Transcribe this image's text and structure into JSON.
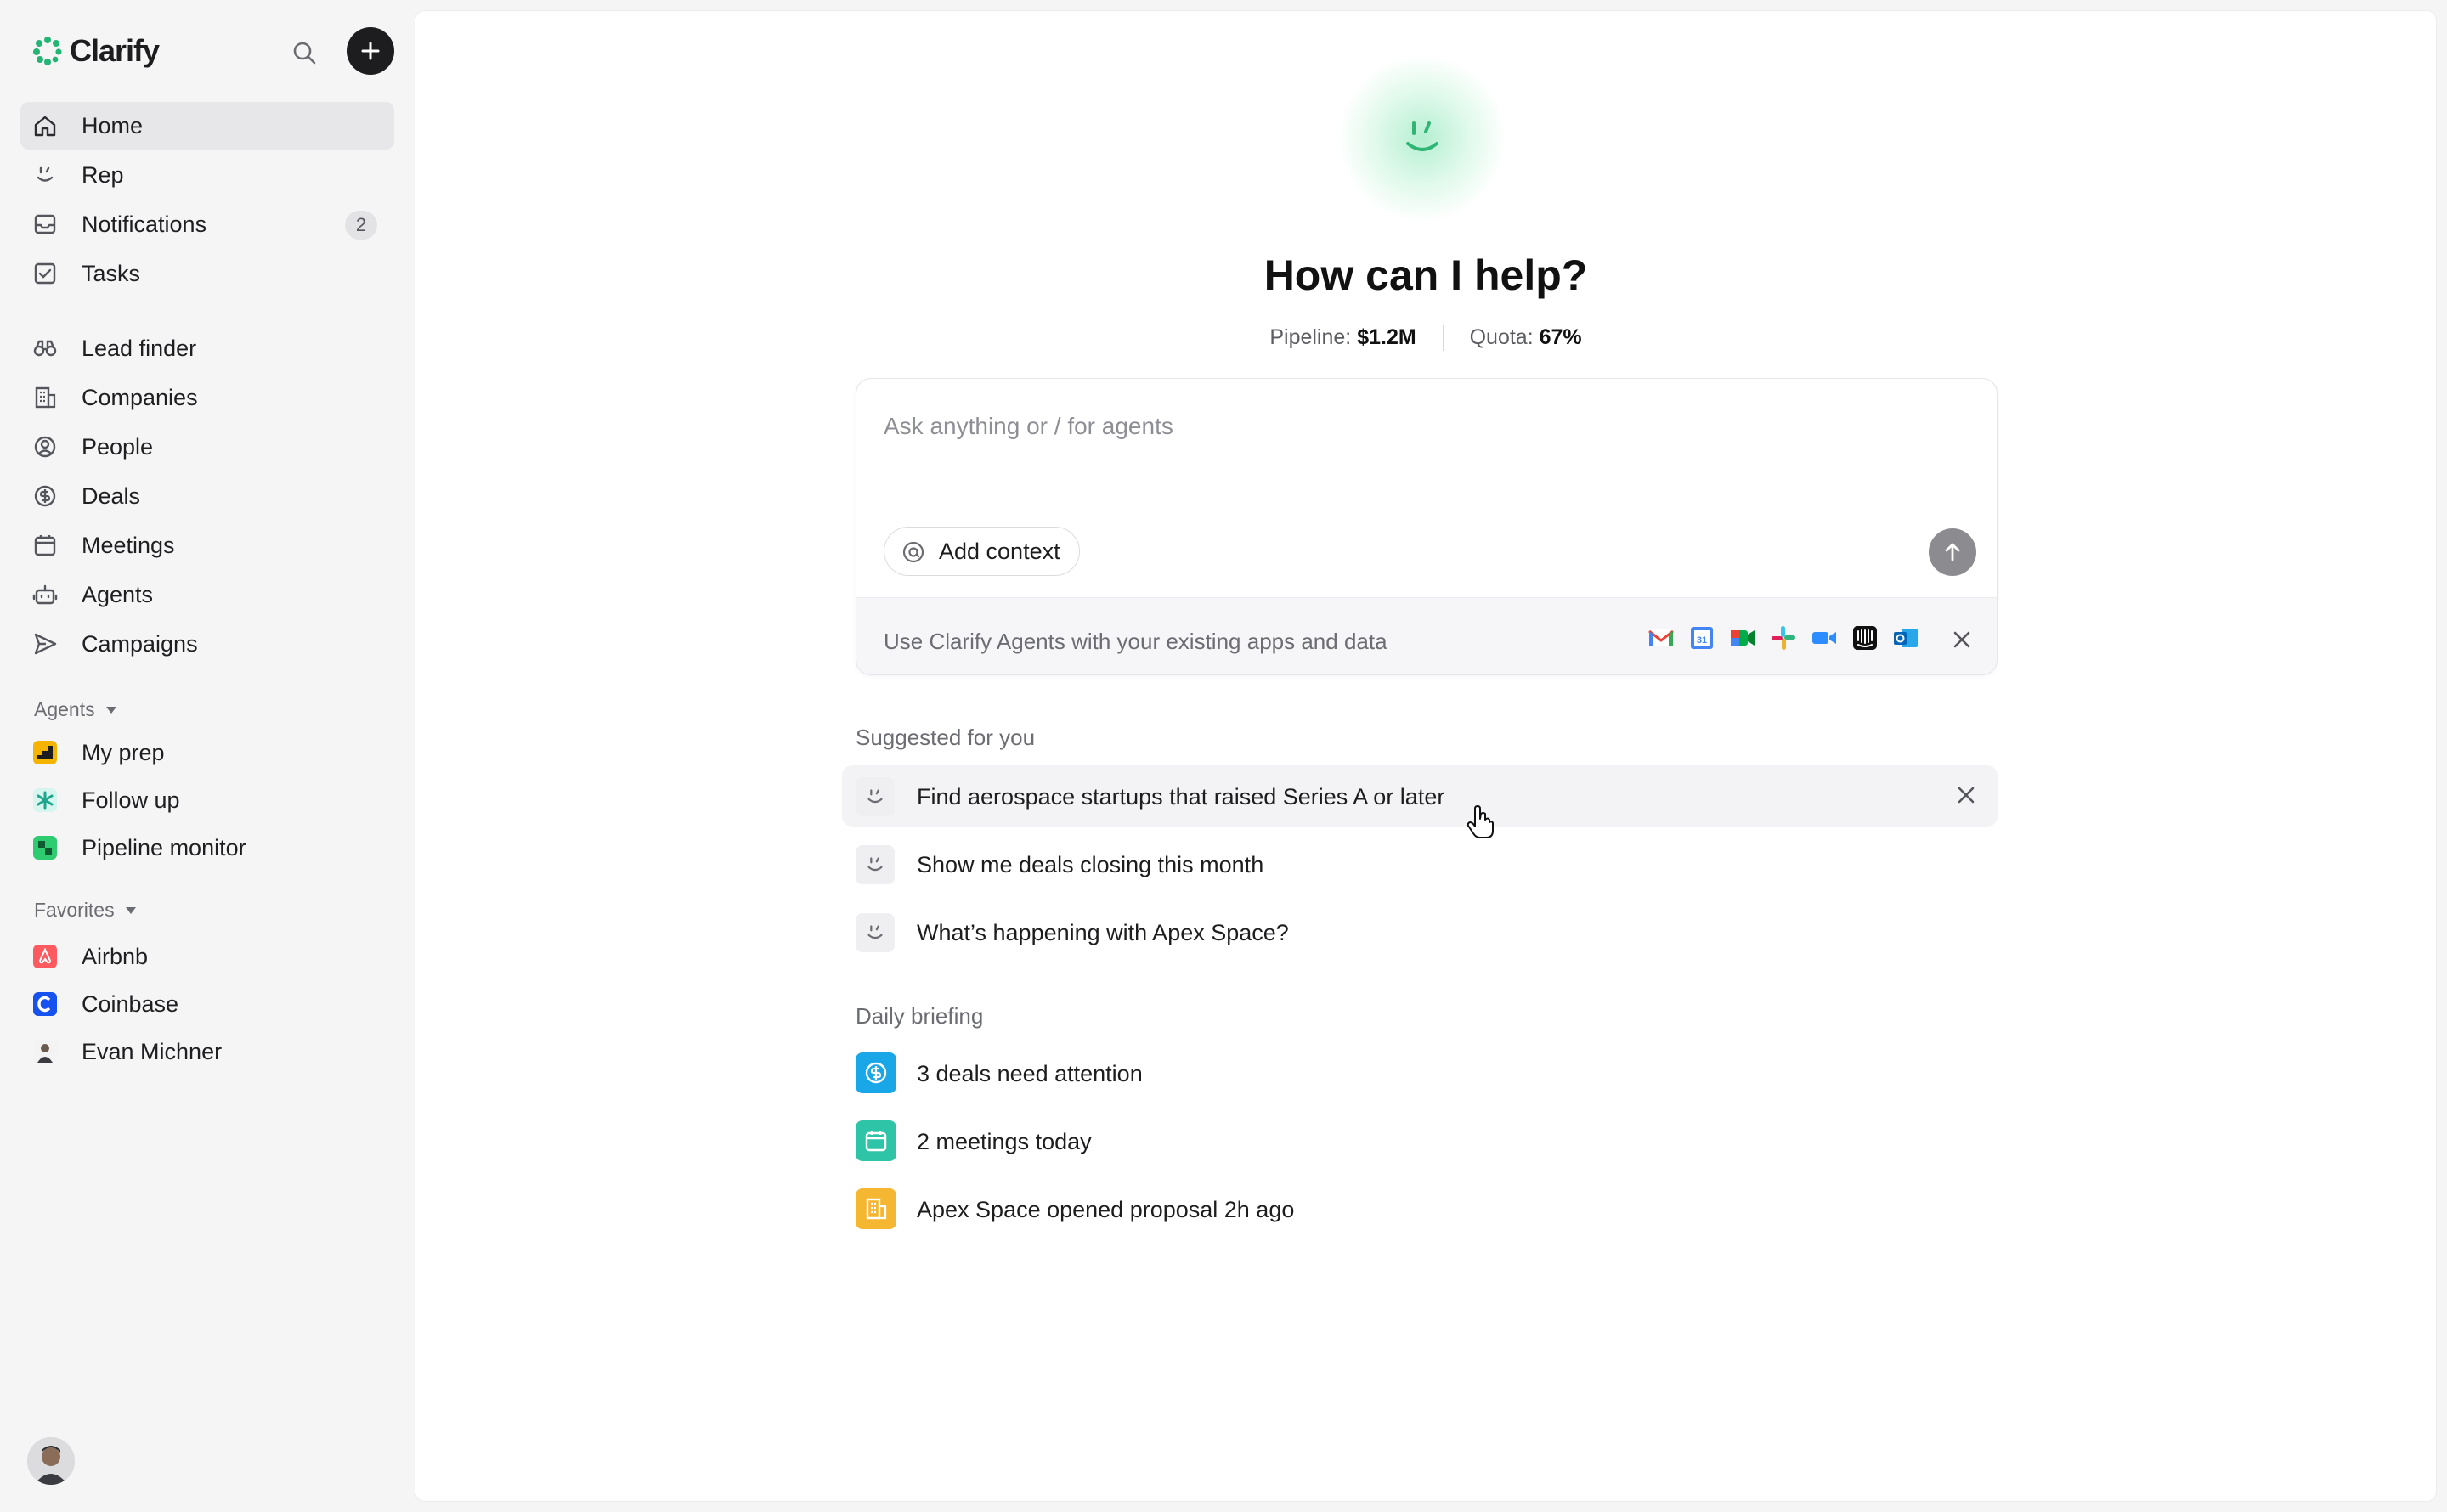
{
  "app": {
    "name": "Clarify",
    "brand_color": "#22b573"
  },
  "sidebar": {
    "nav": [
      {
        "label": "Home",
        "icon": "home-icon",
        "active": true
      },
      {
        "label": "Rep",
        "icon": "rep-face-icon"
      },
      {
        "label": "Notifications",
        "icon": "inbox-icon",
        "badge": "2"
      },
      {
        "label": "Tasks",
        "icon": "checkbox-icon"
      }
    ],
    "records": [
      {
        "label": "Lead finder",
        "icon": "binoculars-icon"
      },
      {
        "label": "Companies",
        "icon": "building-icon"
      },
      {
        "label": "People",
        "icon": "person-circle-icon"
      },
      {
        "label": "Deals",
        "icon": "dollar-circle-icon"
      },
      {
        "label": "Meetings",
        "icon": "calendar-icon"
      },
      {
        "label": "Agents",
        "icon": "robot-icon"
      },
      {
        "label": "Campaigns",
        "icon": "send-icon"
      }
    ],
    "agents_section": {
      "label": "Agents",
      "items": [
        {
          "label": "My prep",
          "color": "#f5b400"
        },
        {
          "label": "Follow up",
          "color": "#2bc4a8"
        },
        {
          "label": "Pipeline monitor",
          "color": "#2ecc71"
        }
      ]
    },
    "favorites_section": {
      "label": "Favorites",
      "items": [
        {
          "label": "Airbnb",
          "color": "#ff5a5f"
        },
        {
          "label": "Coinbase",
          "color": "#1652f0"
        },
        {
          "label": "Evan Michner",
          "color": "#9a9aa0"
        }
      ]
    }
  },
  "main": {
    "title": "How can I help?",
    "pipeline_label": "Pipeline:",
    "pipeline_value": "$1.2M",
    "quota_label": "Quota:",
    "quota_value": "67%",
    "composer": {
      "placeholder": "Ask anything or / for agents",
      "add_context": "Add context",
      "apps_text": "Use Clarify Agents with your existing apps and data",
      "app_icons": [
        "gmail-icon",
        "google-calendar-icon",
        "google-meet-icon",
        "slack-icon",
        "zoom-icon",
        "intercom-icon",
        "outlook-icon"
      ]
    },
    "suggested_label": "Suggested for you",
    "suggestions": [
      "Find aerospace startups that raised Series A or later",
      "Show me deals closing this month",
      "What’s happening with Apex Space?"
    ],
    "briefing_label": "Daily briefing",
    "briefing": [
      {
        "text": "3 deals need attention",
        "icon": "dollar-circle-icon",
        "color": "#1aa7e8"
      },
      {
        "text": "2 meetings today",
        "icon": "calendar-icon",
        "color": "#2ec4a8"
      },
      {
        "text": "Apex Space opened proposal 2h ago",
        "icon": "building-icon",
        "color": "#f5b731"
      }
    ]
  }
}
